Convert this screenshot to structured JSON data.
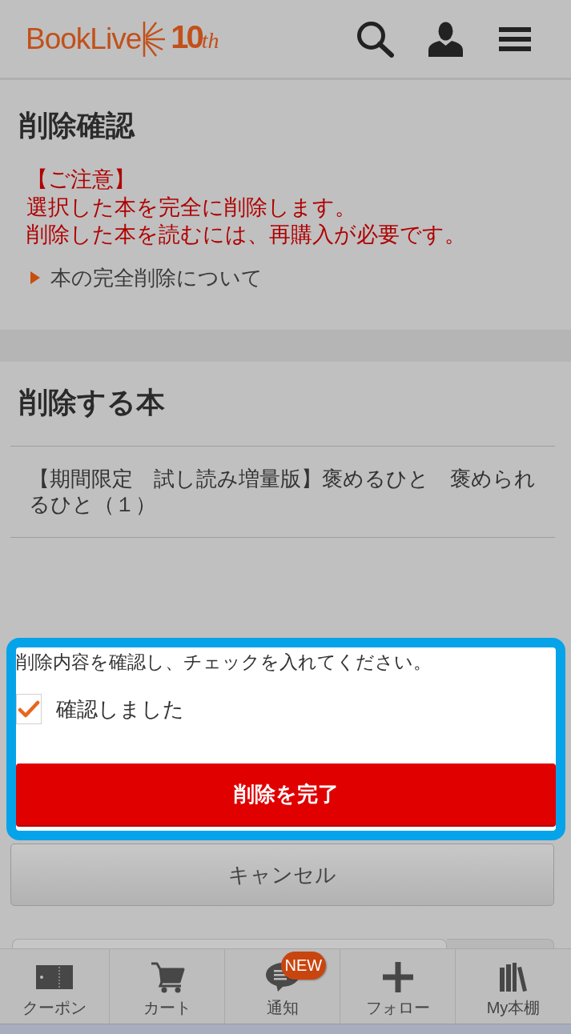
{
  "header": {
    "logo": {
      "name": "BookLive",
      "anniversary": "**10**th"
    }
  },
  "notice_section": {
    "title": "削除確認",
    "warning_heading": "【ご注意】",
    "warning_lines": [
      "選択した本を完全に削除します。",
      "削除した本を読むには、再購入が必要です。"
    ],
    "link": "本の完全削除について"
  },
  "books_section": {
    "title": "削除する本",
    "books": [
      "【期間限定　試し読み増量版】褒めるひと　褒められるひと（１）"
    ]
  },
  "confirm": {
    "instruction": "削除内容を確認し、チェックを入れてください。",
    "checkbox": {
      "label": "確認しました",
      "checked": true
    },
    "submit": "削除を完了"
  },
  "cancel": "キャンセル",
  "bottom_nav": [
    {
      "kind": "coupon",
      "label": "クーポン"
    },
    {
      "kind": "cart",
      "label": "カート"
    },
    {
      "kind": "notice",
      "label": "通知",
      "badge": "NEW"
    },
    {
      "kind": "follow",
      "label": "フォロー"
    },
    {
      "kind": "shelf",
      "label": "My本棚"
    }
  ]
}
